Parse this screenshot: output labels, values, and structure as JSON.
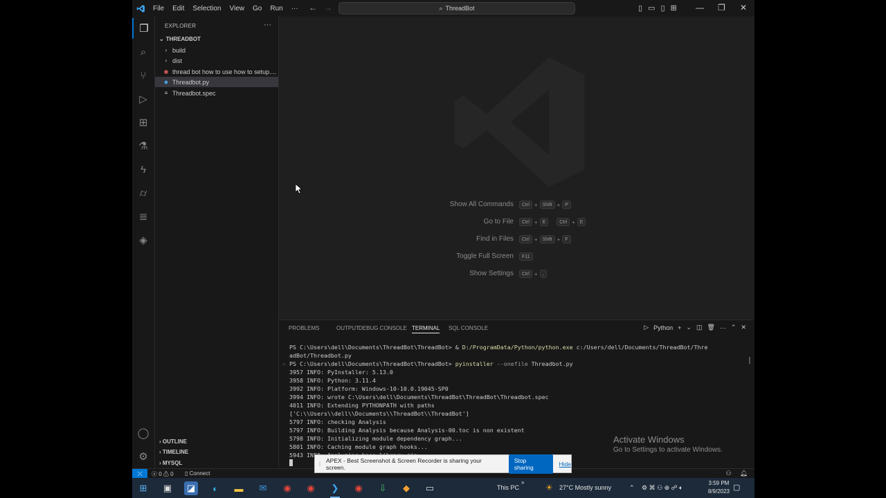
{
  "menu": [
    "File",
    "Edit",
    "Selection",
    "View",
    "Go",
    "Run",
    "···"
  ],
  "command_center": {
    "label": "ThreadBot",
    "icon": "search-icon"
  },
  "explorer": {
    "header": "EXPLORER",
    "more": "···",
    "folder": "THREADBOT",
    "items": [
      {
        "label": "build",
        "icon": "chevron-right-icon"
      },
      {
        "label": "dist",
        "icon": "chevron-right-icon"
      },
      {
        "label": "thread bot how to use how to setup....",
        "icon": "video-file-icon"
      },
      {
        "label": "Threadbot.py",
        "icon": "python-file-icon"
      },
      {
        "label": "Threadbot.spec",
        "icon": "text-file-icon"
      }
    ],
    "sections": [
      "OUTLINE",
      "TIMELINE",
      "MYSQL"
    ]
  },
  "shortcuts": [
    {
      "label": "Show All Commands",
      "keys": [
        [
          "Ctrl",
          "Shift",
          "P"
        ]
      ]
    },
    {
      "label": "Go to File",
      "keys": [
        [
          "Ctrl",
          "E"
        ],
        [
          "Ctrl",
          "E"
        ]
      ]
    },
    {
      "label": "Find in Files",
      "keys": [
        [
          "Ctrl",
          "Shift",
          "F"
        ]
      ]
    },
    {
      "label": "Toggle Full Screen",
      "keys": [
        [
          "F11"
        ]
      ]
    },
    {
      "label": "Show Settings",
      "keys": [
        [
          "Ctrl",
          ","
        ]
      ]
    }
  ],
  "panel": {
    "tabs": [
      "PROBLEMS",
      "OUTPUT",
      "DEBUG CONSOLE",
      "TERMINAL",
      "SQL CONSOLE"
    ],
    "active_tab": "TERMINAL",
    "terminal_profile": "Python",
    "terminal_lines": [
      "PS C:\\Users\\dell\\Documents\\ThreadBot\\ThreadBot> & D:/ProgramData/Python/python.exe c:/Users/dell/Documents/ThreadBot/Thre",
      "adBot/Threadbot.py",
      "PS C:\\Users\\dell\\Documents\\ThreadBot\\ThreadBot> pyinstaller --onefile Threadbot.py",
      "3957 INFO: PyInstaller: 5.13.0",
      "3958 INFO: Python: 3.11.4",
      "3992 INFO: Platform: Windows-10-10.0.19045-SP0",
      "3994 INFO: wrote C:\\Users\\dell\\Documents\\ThreadBot\\ThreadBot\\Threadbot.spec",
      "4011 INFO: Extending PYTHONPATH with paths",
      "['C:\\\\Users\\\\dell\\\\Documents\\\\ThreadBot\\\\ThreadBot']",
      "5797 INFO: checking Analysis",
      "5797 INFO: Building Analysis because Analysis-00.toc is non existent",
      "5798 INFO: Initializing module dependency graph...",
      "5801 INFO: Caching module graph hooks...",
      "5943 INFO: Analyzing base_library.zip ..."
    ]
  },
  "statusbar": {
    "errors": "0",
    "warnings": "0",
    "connect": "Connect"
  },
  "activate_windows": {
    "title": "Activate Windows",
    "subtitle": "Go to Settings to activate Windows."
  },
  "share_notice": {
    "text": "APEX - Best Screenshot & Screen Recorder is sharing your screen.",
    "stop": "Stop sharing",
    "hide": "Hide"
  },
  "taskbar": {
    "this_pc": "This PC",
    "weather": "27°C  Mostly sunny",
    "time": "3:59 PM",
    "date": "8/9/2023"
  },
  "colors": {
    "accent": "#0078d4",
    "background": "#1f1f1f",
    "sidebar": "#181818"
  }
}
